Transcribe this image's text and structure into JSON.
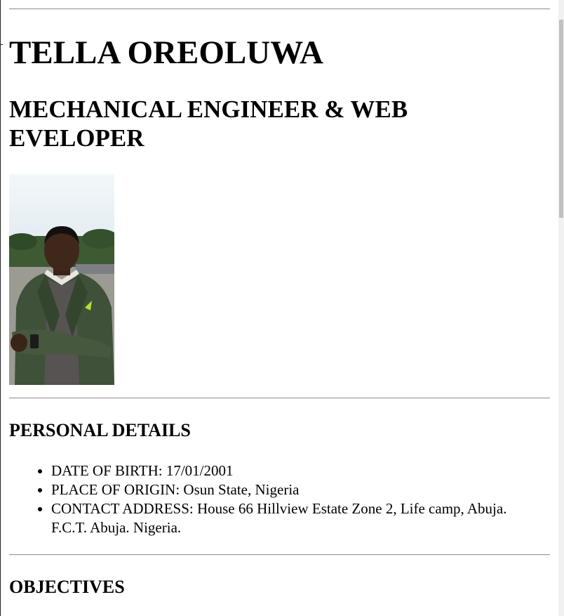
{
  "header": {
    "name": "TELLA OREOLUWA",
    "profession": "MECHANICAL ENGINEER & WEB EVELOPER"
  },
  "profile_photo": {
    "description": "portrait photo"
  },
  "personal_details": {
    "heading": "PERSONAL DETAILS",
    "items": [
      "DATE OF BIRTH: 17/01/2001",
      "PLACE OF ORIGIN: Osun State, Nigeria",
      "CONTACT ADDRESS: House 66 Hillview Estate Zone 2, Life camp, Abuja. F.C.T. Abuja. Nigeria."
    ]
  },
  "objectives": {
    "heading": "OBJECTIVES"
  },
  "colors": {
    "text": "#000000",
    "rule": "#9a9a9a",
    "background": "#ffffff",
    "scrollbar_thumb": "#c1c1c1"
  }
}
